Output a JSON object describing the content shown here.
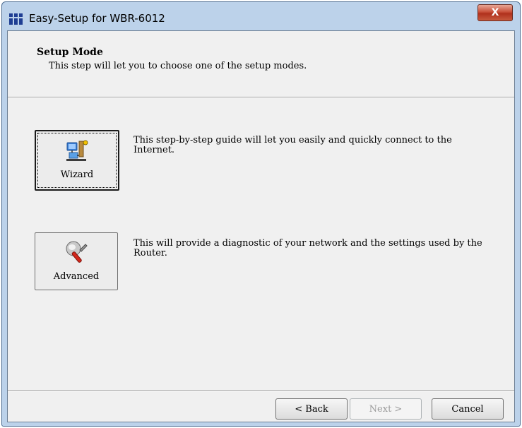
{
  "window": {
    "title": "Easy-Setup for WBR-6012",
    "close_label": "X"
  },
  "header": {
    "title": "Setup Mode",
    "description": "This step will let you to choose one of the setup modes."
  },
  "options": [
    {
      "label": "Wizard",
      "icon": "wizard-network-icon",
      "description": "This step-by-step guide will let you easily and quickly connect to the Internet.",
      "focused": true
    },
    {
      "label": "Advanced",
      "icon": "advanced-tools-icon",
      "description": "This will provide a diagnostic of your network and the settings used by the Router.",
      "focused": false
    }
  ],
  "footer": {
    "back_label": "< Back",
    "next_label": "Next >",
    "cancel_label": "Cancel",
    "next_disabled": true
  }
}
